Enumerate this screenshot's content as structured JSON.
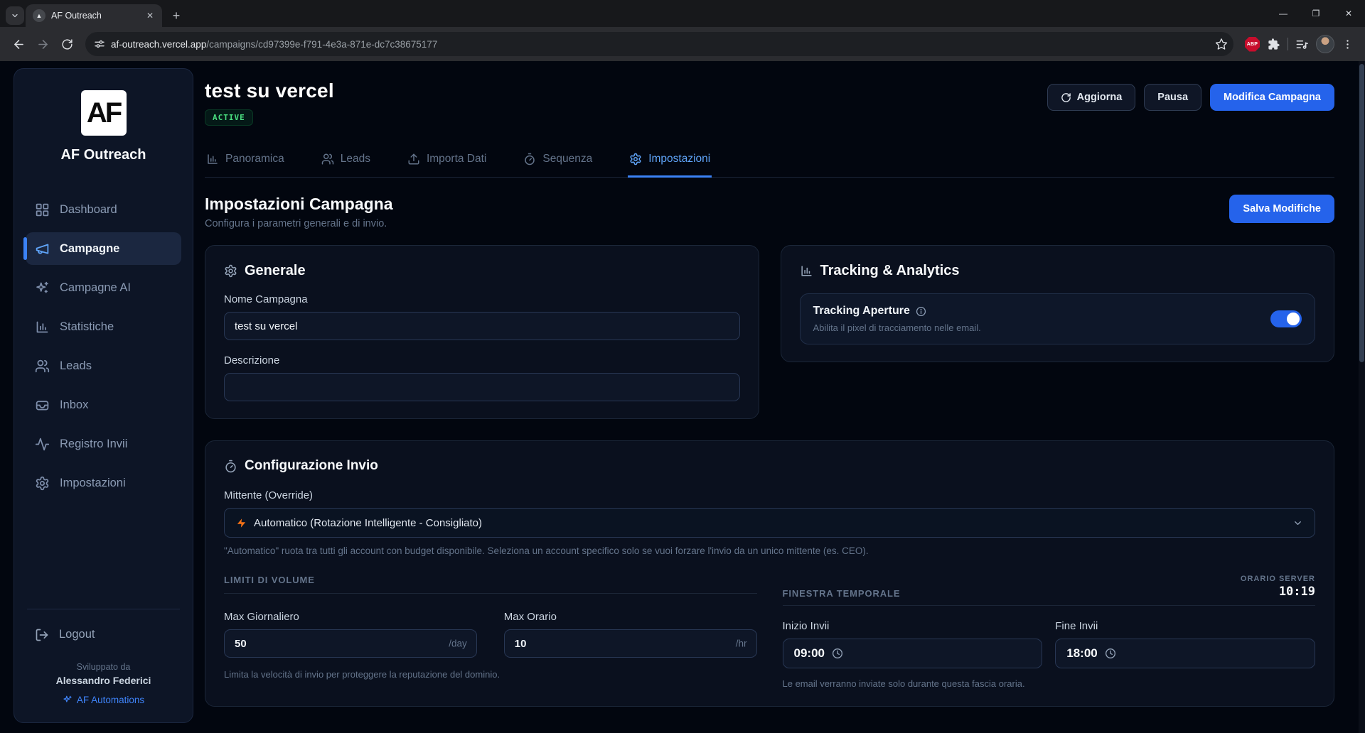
{
  "colors": {
    "accent": "#2563eb",
    "accent_light": "#60a5fa",
    "success": "#4ade80",
    "bolt_orange": "#f97316",
    "abp_red": "#c70d2c"
  },
  "browser": {
    "tab_title": "AF Outreach",
    "url_host": "af-outreach.vercel.app",
    "url_path": "/campaigns/cd97399e-f791-4e3a-871e-dc7c38675177",
    "abp_badge": "ABP"
  },
  "sidebar": {
    "logo_text": "AF",
    "app_name": "AF Outreach",
    "items": [
      {
        "label": "Dashboard"
      },
      {
        "label": "Campagne"
      },
      {
        "label": "Campagne AI"
      },
      {
        "label": "Statistiche"
      },
      {
        "label": "Leads"
      },
      {
        "label": "Inbox"
      },
      {
        "label": "Registro Invii"
      },
      {
        "label": "Impostazioni"
      }
    ],
    "logout_label": "Logout",
    "footer_developed_by": "Sviluppato da",
    "footer_author": "Alessandro Federici",
    "footer_brand": "AF Automations"
  },
  "header": {
    "title": "test su vercel",
    "status": "ACTIVE",
    "refresh_button": "Aggiorna",
    "pause_button": "Pausa",
    "edit_button": "Modifica Campagna"
  },
  "tabs": [
    {
      "label": "Panoramica"
    },
    {
      "label": "Leads"
    },
    {
      "label": "Importa Dati"
    },
    {
      "label": "Sequenza"
    },
    {
      "label": "Impostazioni"
    }
  ],
  "settings": {
    "title": "Impostazioni Campagna",
    "subtitle": "Configura i parametri generali e di invio.",
    "save_button": "Salva Modifiche",
    "general": {
      "title": "Generale",
      "name_label": "Nome Campagna",
      "name_value": "test su vercel",
      "description_label": "Descrizione",
      "description_value": ""
    },
    "tracking": {
      "title": "Tracking & Analytics",
      "toggle_label": "Tracking Aperture",
      "toggle_help": "Abilita il pixel di tracciamento nelle email.",
      "toggle_state": "on"
    },
    "sending": {
      "title": "Configurazione Invio",
      "sender_label": "Mittente (Override)",
      "sender_value": "Automatico (Rotazione Intelligente - Consigliato)",
      "sender_help": "\"Automatico\" ruota tra tutti gli account con budget disponibile. Seleziona un account specifico solo se vuoi forzare l'invio da un unico mittente (es. CEO).",
      "volume": {
        "heading": "LIMITI DI VOLUME",
        "daily_label": "Max Giornaliero",
        "daily_value": "50",
        "daily_unit": "/day",
        "hourly_label": "Max Orario",
        "hourly_value": "10",
        "hourly_unit": "/hr",
        "help": "Limita la velocità di invio per proteggere la reputazione del dominio."
      },
      "window": {
        "heading": "FINESTRA TEMPORALE",
        "server_time_label": "ORARIO SERVER",
        "server_time": "10:19",
        "start_label": "Inizio Invii",
        "start_value": "09:00",
        "end_label": "Fine Invii",
        "end_value": "18:00",
        "help": "Le email verranno inviate solo durante questa fascia oraria."
      }
    }
  }
}
